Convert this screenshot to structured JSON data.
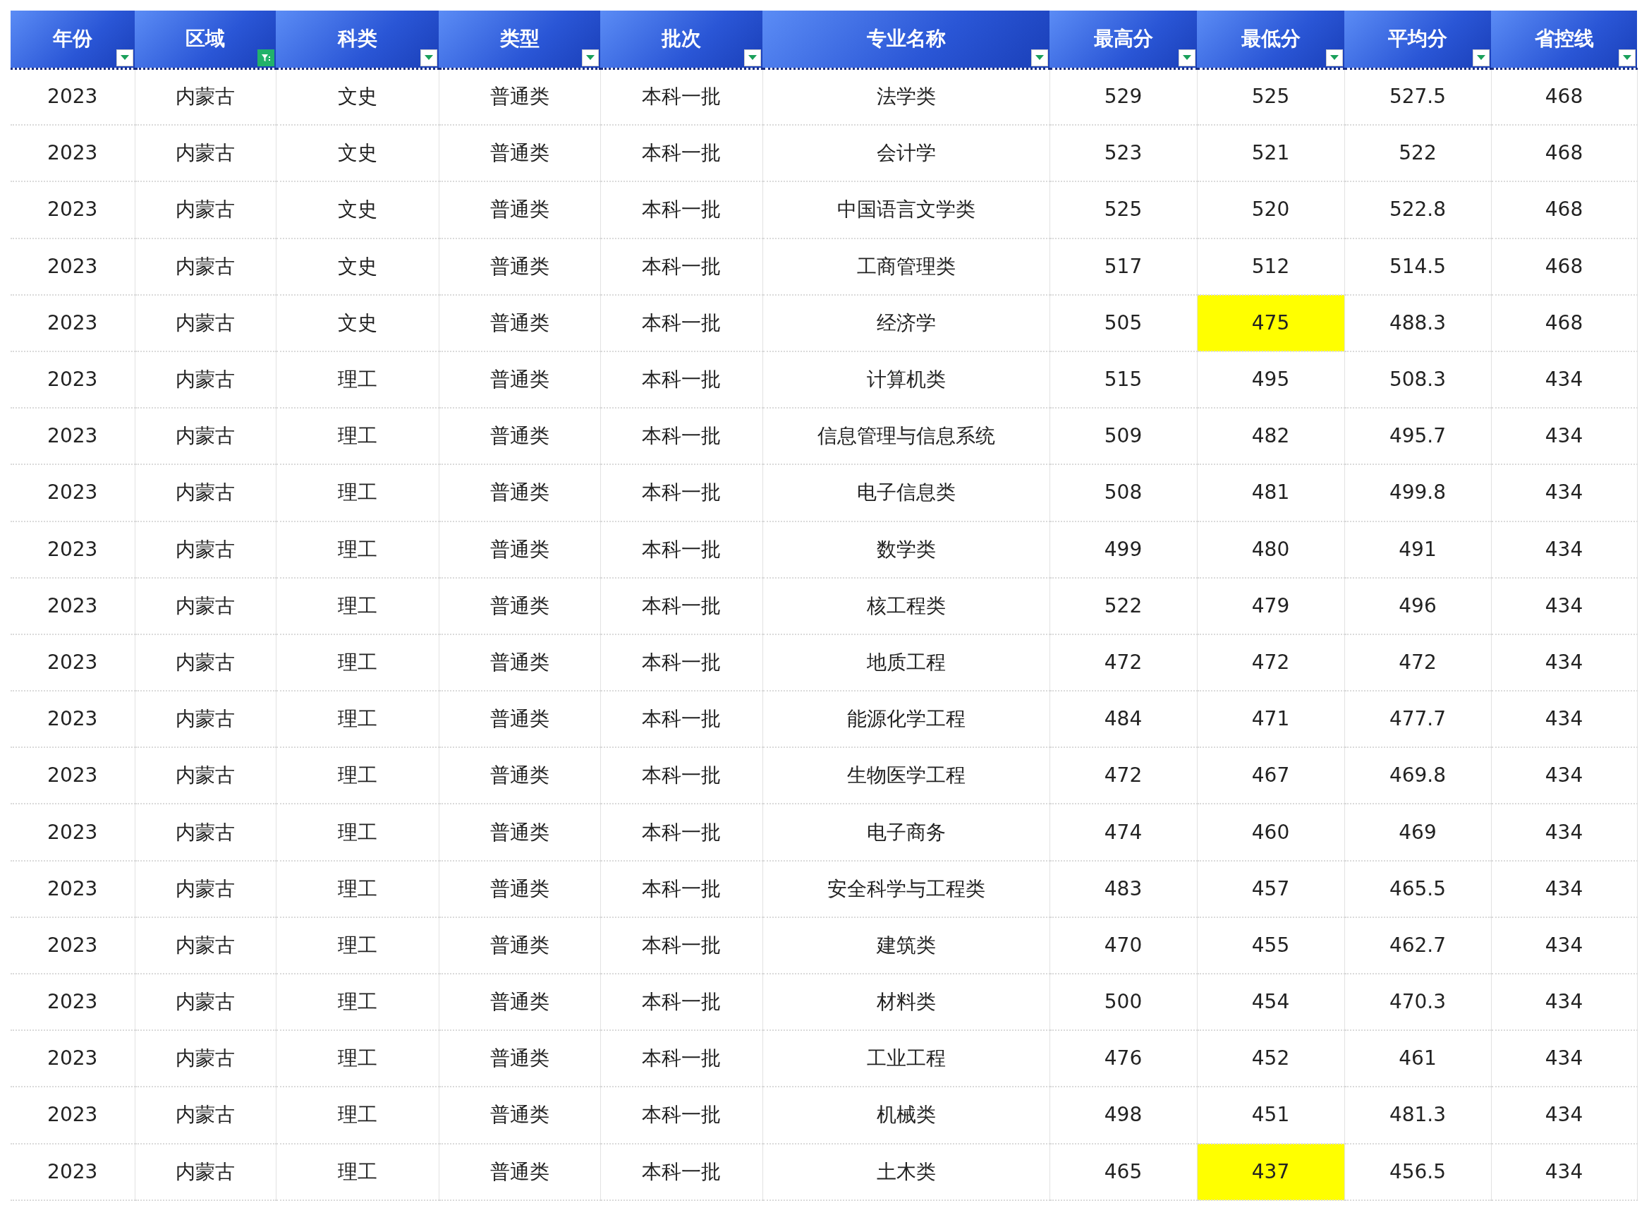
{
  "table": {
    "columns": [
      {
        "label": "年份",
        "filtered": false
      },
      {
        "label": "区域",
        "filtered": true
      },
      {
        "label": "科类",
        "filtered": false
      },
      {
        "label": "类型",
        "filtered": false
      },
      {
        "label": "批次",
        "filtered": false
      },
      {
        "label": "专业名称",
        "filtered": false
      },
      {
        "label": "最高分",
        "filtered": false
      },
      {
        "label": "最低分",
        "filtered": false
      },
      {
        "label": "平均分",
        "filtered": false
      },
      {
        "label": "省控线",
        "filtered": false
      }
    ],
    "rows": [
      {
        "cells": [
          "2023",
          "内蒙古",
          "文史",
          "普通类",
          "本科一批",
          "法学类",
          "529",
          "525",
          "527.5",
          "468"
        ],
        "min_highlighted": false
      },
      {
        "cells": [
          "2023",
          "内蒙古",
          "文史",
          "普通类",
          "本科一批",
          "会计学",
          "523",
          "521",
          "522",
          "468"
        ],
        "min_highlighted": false
      },
      {
        "cells": [
          "2023",
          "内蒙古",
          "文史",
          "普通类",
          "本科一批",
          "中国语言文学类",
          "525",
          "520",
          "522.8",
          "468"
        ],
        "min_highlighted": false
      },
      {
        "cells": [
          "2023",
          "内蒙古",
          "文史",
          "普通类",
          "本科一批",
          "工商管理类",
          "517",
          "512",
          "514.5",
          "468"
        ],
        "min_highlighted": false
      },
      {
        "cells": [
          "2023",
          "内蒙古",
          "文史",
          "普通类",
          "本科一批",
          "经济学",
          "505",
          "475",
          "488.3",
          "468"
        ],
        "min_highlighted": true
      },
      {
        "cells": [
          "2023",
          "内蒙古",
          "理工",
          "普通类",
          "本科一批",
          "计算机类",
          "515",
          "495",
          "508.3",
          "434"
        ],
        "min_highlighted": false
      },
      {
        "cells": [
          "2023",
          "内蒙古",
          "理工",
          "普通类",
          "本科一批",
          "信息管理与信息系统",
          "509",
          "482",
          "495.7",
          "434"
        ],
        "min_highlighted": false
      },
      {
        "cells": [
          "2023",
          "内蒙古",
          "理工",
          "普通类",
          "本科一批",
          "电子信息类",
          "508",
          "481",
          "499.8",
          "434"
        ],
        "min_highlighted": false
      },
      {
        "cells": [
          "2023",
          "内蒙古",
          "理工",
          "普通类",
          "本科一批",
          "数学类",
          "499",
          "480",
          "491",
          "434"
        ],
        "min_highlighted": false
      },
      {
        "cells": [
          "2023",
          "内蒙古",
          "理工",
          "普通类",
          "本科一批",
          "核工程类",
          "522",
          "479",
          "496",
          "434"
        ],
        "min_highlighted": false
      },
      {
        "cells": [
          "2023",
          "内蒙古",
          "理工",
          "普通类",
          "本科一批",
          "地质工程",
          "472",
          "472",
          "472",
          "434"
        ],
        "min_highlighted": false
      },
      {
        "cells": [
          "2023",
          "内蒙古",
          "理工",
          "普通类",
          "本科一批",
          "能源化学工程",
          "484",
          "471",
          "477.7",
          "434"
        ],
        "min_highlighted": false
      },
      {
        "cells": [
          "2023",
          "内蒙古",
          "理工",
          "普通类",
          "本科一批",
          "生物医学工程",
          "472",
          "467",
          "469.8",
          "434"
        ],
        "min_highlighted": false
      },
      {
        "cells": [
          "2023",
          "内蒙古",
          "理工",
          "普通类",
          "本科一批",
          "电子商务",
          "474",
          "460",
          "469",
          "434"
        ],
        "min_highlighted": false
      },
      {
        "cells": [
          "2023",
          "内蒙古",
          "理工",
          "普通类",
          "本科一批",
          "安全科学与工程类",
          "483",
          "457",
          "465.5",
          "434"
        ],
        "min_highlighted": false
      },
      {
        "cells": [
          "2023",
          "内蒙古",
          "理工",
          "普通类",
          "本科一批",
          "建筑类",
          "470",
          "455",
          "462.7",
          "434"
        ],
        "min_highlighted": false
      },
      {
        "cells": [
          "2023",
          "内蒙古",
          "理工",
          "普通类",
          "本科一批",
          "材料类",
          "500",
          "454",
          "470.3",
          "434"
        ],
        "min_highlighted": false
      },
      {
        "cells": [
          "2023",
          "内蒙古",
          "理工",
          "普通类",
          "本科一批",
          "工业工程",
          "476",
          "452",
          "461",
          "434"
        ],
        "min_highlighted": false
      },
      {
        "cells": [
          "2023",
          "内蒙古",
          "理工",
          "普通类",
          "本科一批",
          "机械类",
          "498",
          "451",
          "481.3",
          "434"
        ],
        "min_highlighted": false
      },
      {
        "cells": [
          "2023",
          "内蒙古",
          "理工",
          "普通类",
          "本科一批",
          "土木类",
          "465",
          "437",
          "456.5",
          "434"
        ],
        "min_highlighted": true
      }
    ]
  }
}
